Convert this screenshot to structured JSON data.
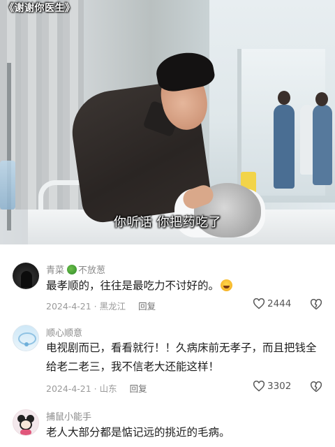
{
  "video": {
    "title_overlay": "《谢谢你医生》",
    "subtitle": "你听话  你把药吃了"
  },
  "comments": [
    {
      "username": "青菜",
      "badge_icon": "broccoli-icon",
      "username_suffix": "不放葱",
      "text": "最孝顺的，往往是最吃力不讨好的。",
      "emoji": "laughing-crying-emoji",
      "date_location": "2024-4-21 · 黑龙江",
      "reply_label": "回复",
      "likes": "2444"
    },
    {
      "username": "顺心顺意",
      "text": "电视剧而已，看看就行！！久病床前无孝子，而且把钱全给老二老三，我不信老大还能这样！",
      "date_location": "2024-4-21 · 山东",
      "reply_label": "回复",
      "likes": "3302"
    },
    {
      "username": "捕鼠小能手",
      "text": "老人大部分都是惦记远的挑近的毛病。"
    }
  ],
  "colors": {
    "username": "#8a8a8a",
    "text": "#1c1c1c",
    "meta": "#9a9a9a"
  }
}
